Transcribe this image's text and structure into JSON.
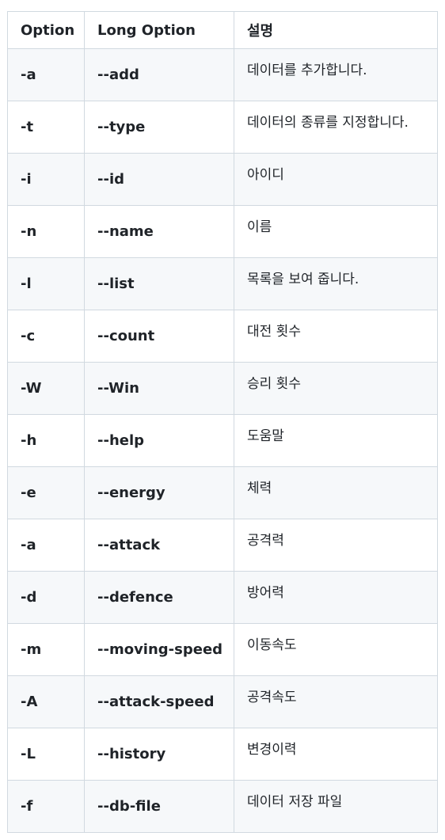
{
  "table": {
    "headers": [
      "Option",
      "Long Option",
      "설명"
    ],
    "rows": [
      {
        "option": "-a",
        "long": "--add",
        "desc": "데이터를 추가합니다."
      },
      {
        "option": "-t",
        "long": "--type",
        "desc": "데이터의 종류를 지정합니다."
      },
      {
        "option": "-i",
        "long": "--id",
        "desc": "아이디"
      },
      {
        "option": "-n",
        "long": "--name",
        "desc": "이름"
      },
      {
        "option": "-l",
        "long": "--list",
        "desc": "목록을 보여 줍니다."
      },
      {
        "option": "-c",
        "long": "--count",
        "desc": "대전 횟수"
      },
      {
        "option": "-W",
        "long": "--Win",
        "desc": "승리 횟수"
      },
      {
        "option": "-h",
        "long": "--help",
        "desc": "도움말"
      },
      {
        "option": "-e",
        "long": "--energy",
        "desc": "체력"
      },
      {
        "option": "-a",
        "long": "--attack",
        "desc": "공격력"
      },
      {
        "option": "-d",
        "long": "--defence",
        "desc": "방어력"
      },
      {
        "option": "-m",
        "long": "--moving-speed",
        "desc": "이동속도"
      },
      {
        "option": "-A",
        "long": "--attack-speed",
        "desc": "공격속도"
      },
      {
        "option": "-L",
        "long": "--history",
        "desc": "변경이력"
      },
      {
        "option": "-f",
        "long": "--db-file",
        "desc": "데이터 저장 파일"
      }
    ]
  }
}
